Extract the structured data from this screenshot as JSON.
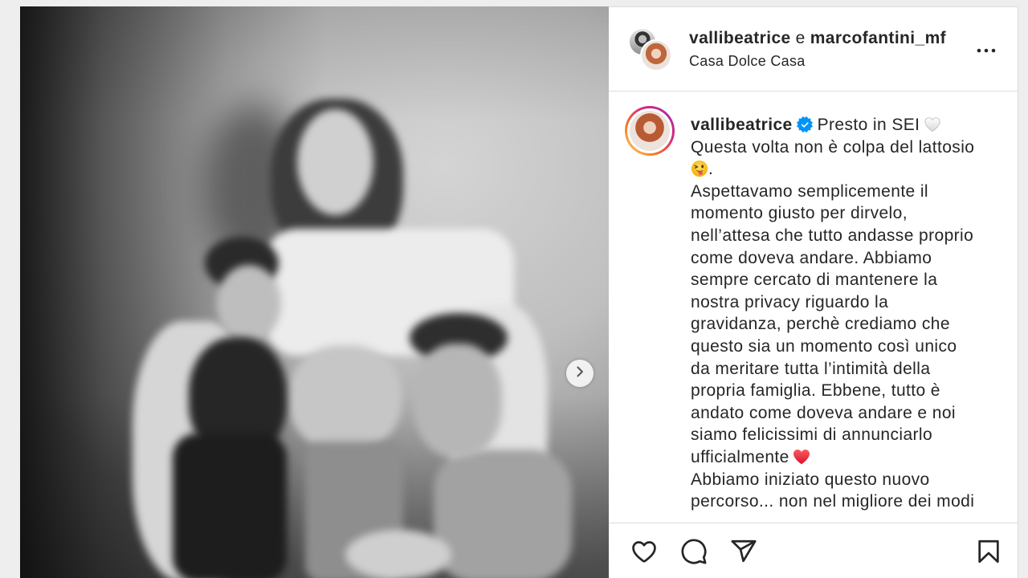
{
  "colors": {
    "page_background": "#eeeeee",
    "panel_background": "#ffffff",
    "text": "#262626",
    "border": "#dbdbdb",
    "verified_blue": "#0095f6",
    "story_ring": [
      "#feda75",
      "#fa7e1e",
      "#d62976",
      "#962fbf"
    ]
  },
  "media": {
    "next_icon": "chevron-right-icon"
  },
  "header": {
    "username_1": "vallibeatrice",
    "conjunction": "e",
    "username_2": "marcofantini_mf",
    "location": "Casa Dolce Casa",
    "more_icon": "more-horizontal-icon"
  },
  "caption": {
    "username": "vallibeatrice",
    "verified_icon": "verified-badge-icon",
    "emoji_icons": [
      "white-heart-emoji",
      "winking-face-with-tongue-emoji",
      "red-heart-emoji"
    ],
    "lines": [
      "Presto in SEI",
      "Questa volta non è colpa del lattosio",
      ".",
      "Aspettavamo semplicemente il",
      "momento giusto per dirvelo,",
      "nell’attesa che tutto andasse proprio",
      "come doveva andare. Abbiamo",
      "sempre cercato di mantenere la",
      "nostra privacy riguardo la",
      "gravidanza, perchè crediamo che",
      "questo sia un momento così unico",
      "da meritare tutta l’intimità della",
      "propria famiglia. Ebbene, tutto è",
      "andato come doveva andare e noi",
      "siamo felicissimi di annunciarlo",
      "ufficialmente",
      "Abbiamo iniziato questo nuovo",
      "percorso... non nel migliore dei modi"
    ]
  },
  "actions": {
    "icons": [
      "like-heart-icon",
      "comment-icon",
      "share-icon",
      "save-bookmark-icon"
    ]
  }
}
